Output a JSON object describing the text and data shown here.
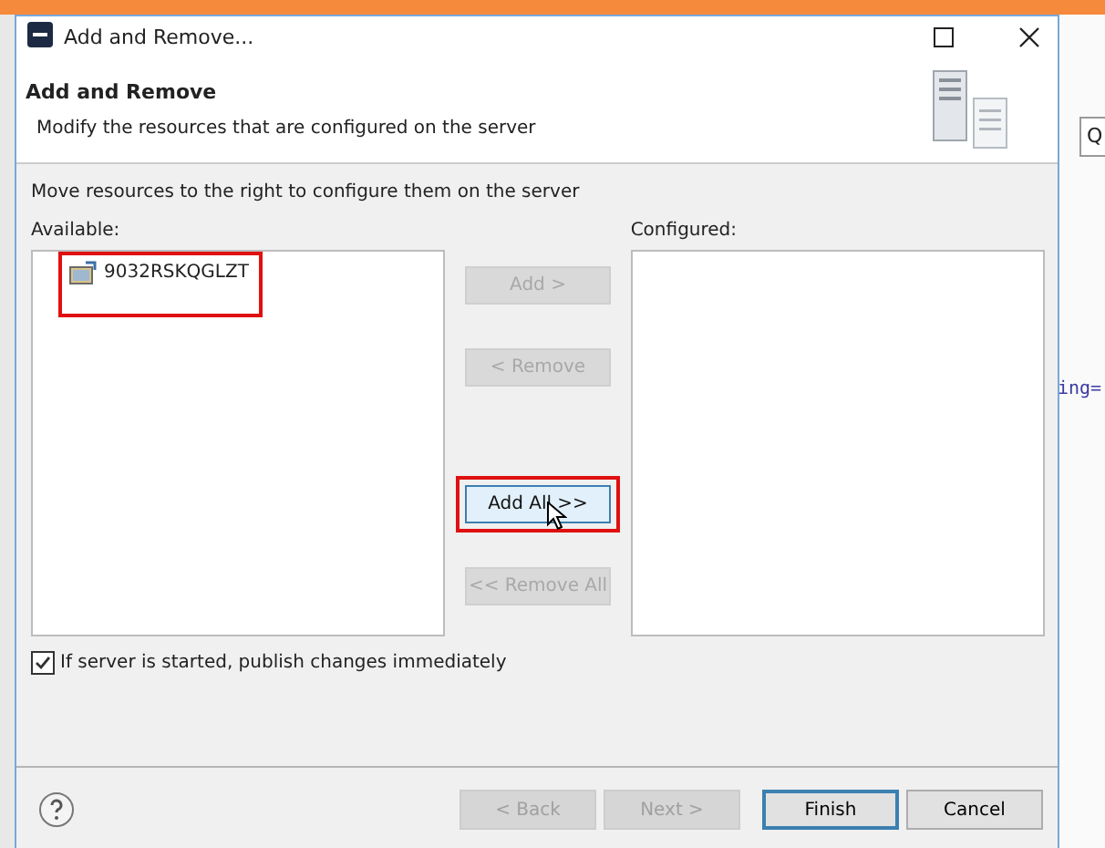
{
  "window": {
    "title": "Add and Remove..."
  },
  "header": {
    "title": "Add and Remove",
    "subtitle": "Modify the resources that are configured on the server"
  },
  "instruction": "Move resources to the right to configure them on the server",
  "available": {
    "label": "Available:",
    "items": [
      {
        "name": "9032RSKQGLZT",
        "annotated": true
      }
    ]
  },
  "configured": {
    "label": "Configured:"
  },
  "move_buttons": [
    {
      "label": "Add >",
      "disabled": true,
      "annotated": false
    },
    {
      "label": "< Remove",
      "disabled": true,
      "annotated": false
    },
    {
      "label": "Add All >>",
      "disabled": false,
      "annotated": true
    },
    {
      "label": "<< Remove All",
      "disabled": true,
      "annotated": false
    }
  ],
  "publish_option": {
    "label": "If server is started, publish changes immediately",
    "checked": true
  },
  "footer_buttons": [
    {
      "label": "< Back",
      "disabled": true,
      "default": false
    },
    {
      "label": "Next >",
      "disabled": true,
      "default": false
    },
    {
      "label": "Finish",
      "disabled": false,
      "default": true
    },
    {
      "label": "Cancel",
      "disabled": false,
      "default": false
    }
  ],
  "background": {
    "editor_text": "ing=",
    "search_text": "Q"
  }
}
